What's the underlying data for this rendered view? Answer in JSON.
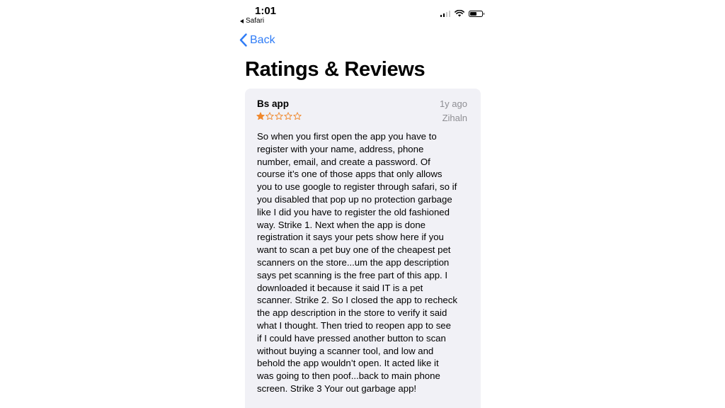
{
  "status_bar": {
    "time": "1:01",
    "back_to_app": "Safari",
    "signal_icon": "cellular-signal-icon",
    "wifi_icon": "wifi-icon",
    "battery_icon": "battery-icon"
  },
  "nav": {
    "back_label": "Back",
    "back_icon": "chevron-left-icon",
    "accent_color": "#2f7cf6"
  },
  "page": {
    "title": "Ratings & Reviews"
  },
  "review": {
    "title": "Bs app",
    "date": "1y ago",
    "author": "Zihaln",
    "rating": 1,
    "max_rating": 5,
    "star_color": "#f0882c",
    "body_lines": [
      "So when you first open the app you have to",
      "register with your name, address, phone",
      "number, email, and create a password. Of",
      "course it’s one of those apps that only allows",
      "you to use google to register through safari, so if",
      "you disabled that pop up no protection garbage",
      "like I did you have to register the old fashioned",
      "way. Strike 1. Next when the app is done",
      "registration it says your pets show here if you",
      "want to scan a pet buy one of the cheapest pet",
      "scanners on the store...um the app description",
      "says pet scanning is the free part of this app. I",
      "downloaded it because it said IT is a pet",
      "scanner. Strike 2. So I closed the app to recheck",
      "the app description in the store to verify it said",
      "what I thought. Then tried to reopen app to see",
      "if I could have pressed another button to scan",
      "without buying a scanner tool, and low and",
      "behold the app wouldn’t open. It acted like it",
      "was going to then poof...back to main phone",
      "screen. Strike 3 Your out garbage app!"
    ]
  }
}
